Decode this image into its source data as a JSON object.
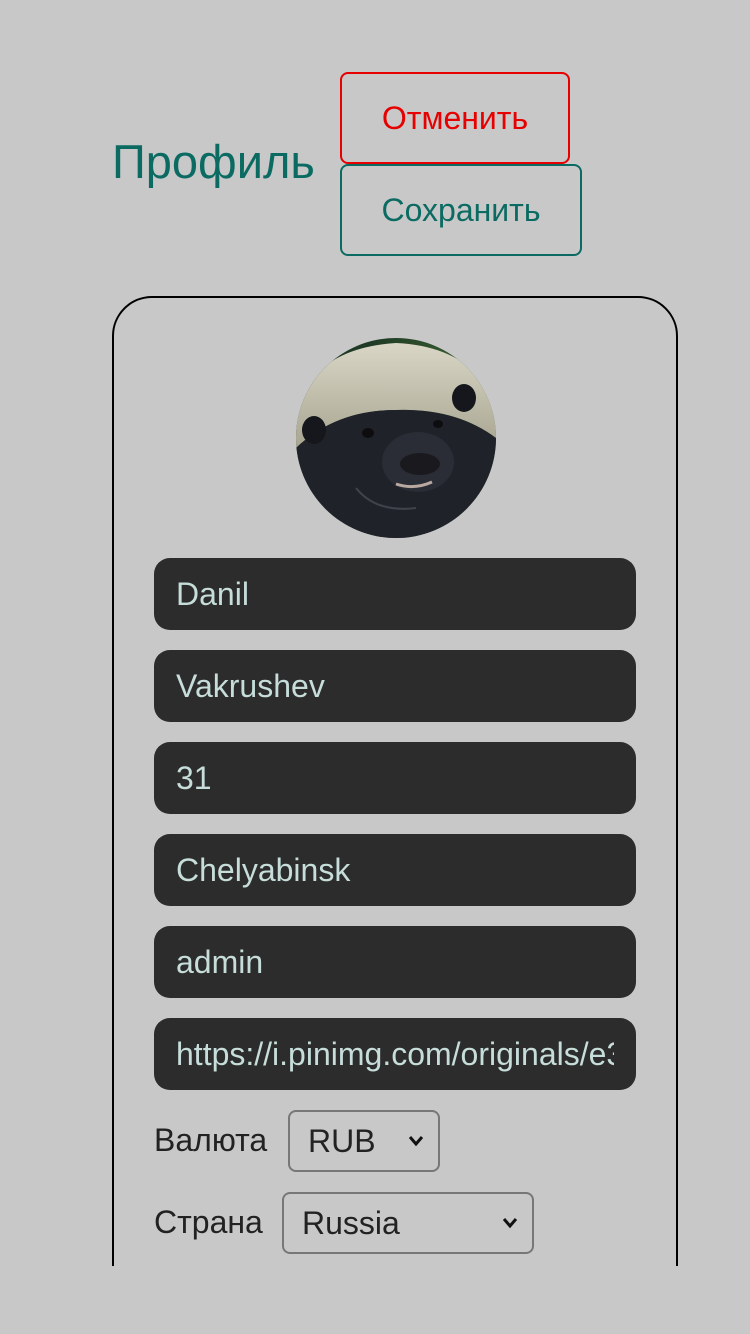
{
  "header": {
    "title": "Профиль",
    "cancel_label": "Отменить",
    "save_label": "Сохранить"
  },
  "colors": {
    "background": "#c8c8c8",
    "accent": "#0b6b62",
    "danger": "#e60000",
    "field_bg": "#2c2c2c",
    "field_text": "#c6ddda"
  },
  "profile": {
    "avatar_icon": "honey-badger-photo",
    "first_name": "Danil",
    "last_name": "Vakrushev",
    "age": "31",
    "city": "Chelyabinsk",
    "role": "admin",
    "avatar_url": "https://i.pinimg.com/originals/e3"
  },
  "currency": {
    "label": "Валюта",
    "selected": "RUB"
  },
  "country": {
    "label": "Страна",
    "selected": "Russia"
  }
}
